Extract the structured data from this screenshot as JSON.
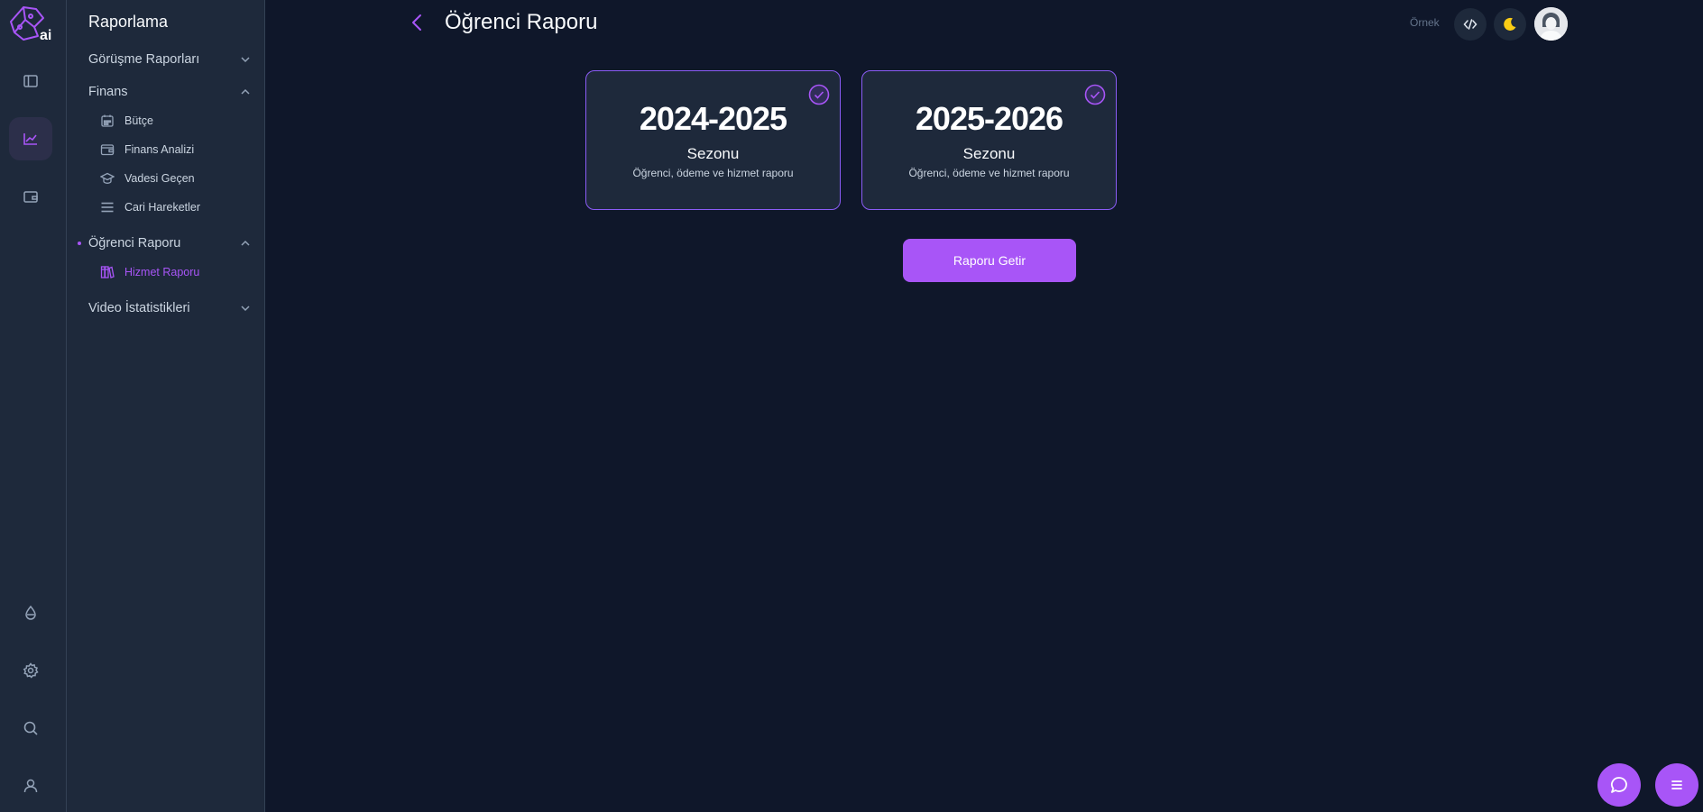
{
  "sidebar": {
    "title": "Raporlama",
    "groups": [
      {
        "label": "Görüşme Raporları",
        "expanded": false
      },
      {
        "label": "Finans",
        "expanded": true,
        "items": [
          {
            "label": "Bütçe",
            "icon": "calculator-icon"
          },
          {
            "label": "Finans Analizi",
            "icon": "wallet-icon"
          },
          {
            "label": "Vadesi Geçen",
            "icon": "graduation-cap-icon"
          },
          {
            "label": "Cari Hareketler",
            "icon": "list-icon"
          }
        ]
      },
      {
        "label": "Öğrenci Raporu",
        "expanded": true,
        "active": true,
        "items": [
          {
            "label": "Hizmet Raporu",
            "icon": "books-icon",
            "active": true
          }
        ]
      },
      {
        "label": "Video İstatistikleri",
        "expanded": false
      }
    ]
  },
  "rail": {
    "icons": [
      "sidebar-toggle-icon",
      "chart-icon",
      "wallet-icon",
      "drop-icon",
      "gear-icon",
      "search-icon",
      "user-icon"
    ],
    "active": "chart-icon"
  },
  "header": {
    "title": "Öğrenci Raporu",
    "label": "Örnek"
  },
  "seasons": [
    {
      "year": "2024-2025",
      "season": "Sezonu",
      "desc": "Öğrenci, ödeme ve hizmet raporu",
      "selected": true
    },
    {
      "year": "2025-2026",
      "season": "Sezonu",
      "desc": "Öğrenci, ödeme ve hizmet raporu",
      "selected": true
    }
  ],
  "actions": {
    "fetch_report": "Raporu Getir"
  },
  "colors": {
    "accent": "#a855f7",
    "background": "#0f172a",
    "panel": "#1e293b",
    "moon": "#facc15"
  }
}
